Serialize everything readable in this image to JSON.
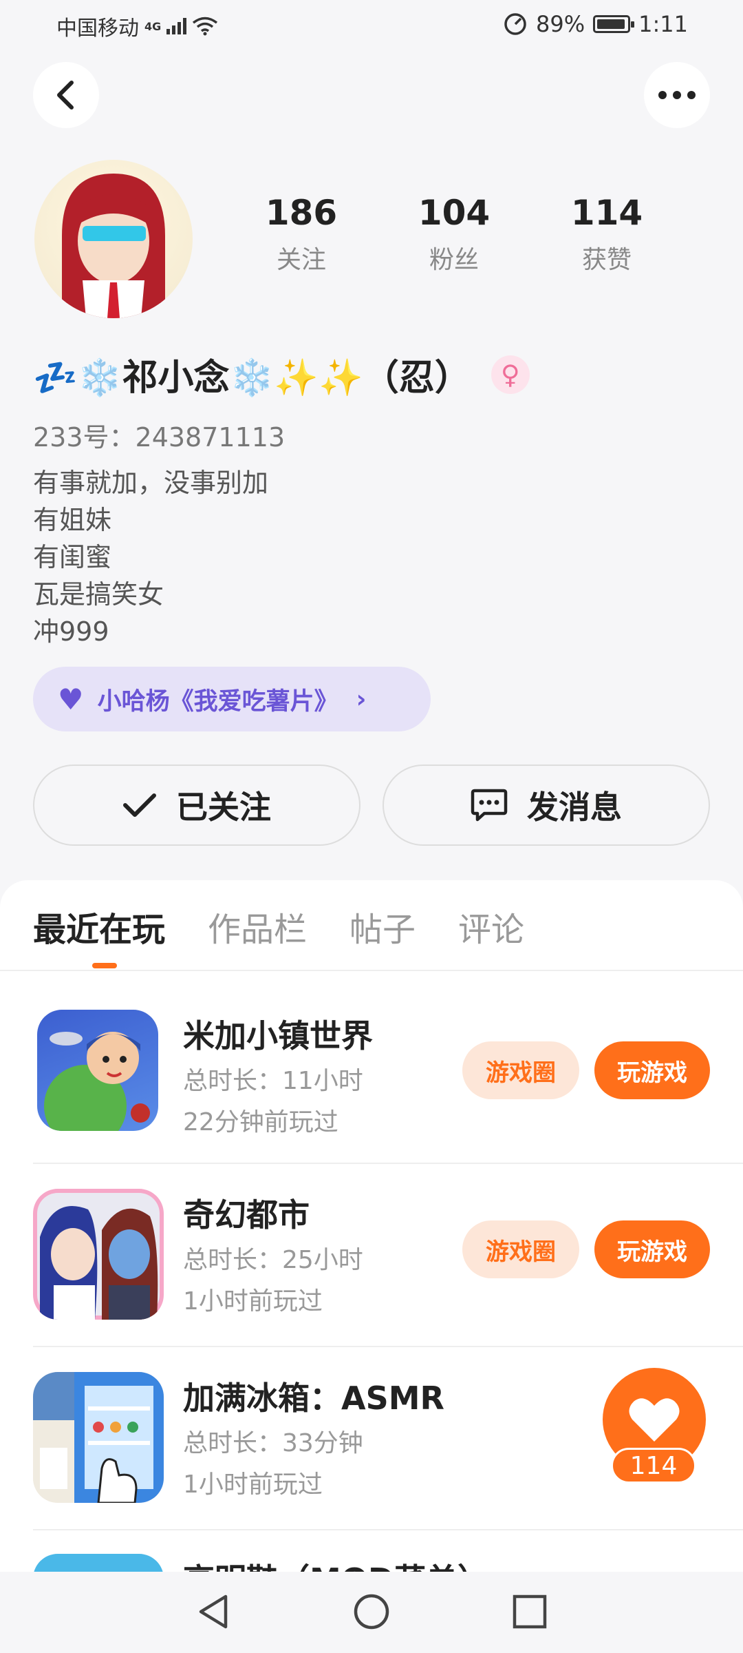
{
  "status_bar": {
    "carrier": "中国移动",
    "network": "4G",
    "battery": "89%",
    "time": "1:11"
  },
  "profile": {
    "nickname": "💤❄️祁小念❄️✨✨（忍）",
    "gender_symbol": "♀",
    "uid": "233号：243871113",
    "stats": [
      {
        "value": "186",
        "label": "关注"
      },
      {
        "value": "104",
        "label": "粉丝"
      },
      {
        "value": "114",
        "label": "获赞"
      }
    ],
    "bio_lines": [
      "有事就加，没事别加",
      "有姐妹",
      "有闺蜜",
      "瓦是搞笑女",
      "冲999"
    ],
    "pill_text": "小哈杨《我爱吃薯片》",
    "follow_label": "已关注",
    "message_label": "发消息"
  },
  "tabs": [
    "最近在玩",
    "作品栏",
    "帖子",
    "评论"
  ],
  "games": [
    {
      "name": "米加小镇世界",
      "duration": "总时长：11小时",
      "last_played": "22分钟前玩过",
      "circle_label": "游戏圈",
      "play_label": "玩游戏"
    },
    {
      "name": "奇幻都市",
      "duration": "总时长：25小时",
      "last_played": "1小时前玩过",
      "circle_label": "游戏圈",
      "play_label": "玩游戏"
    },
    {
      "name": "加满冰箱：ASMR",
      "duration": "总时长：33分钟",
      "last_played": "1小时前玩过"
    },
    {
      "name": "高明鞋（MOD菜单）"
    }
  ],
  "like_count": "114",
  "colors": {
    "accent": "#ff6f1a",
    "pill_bg": "#e6e2f8",
    "pill_text": "#6a55d6"
  }
}
